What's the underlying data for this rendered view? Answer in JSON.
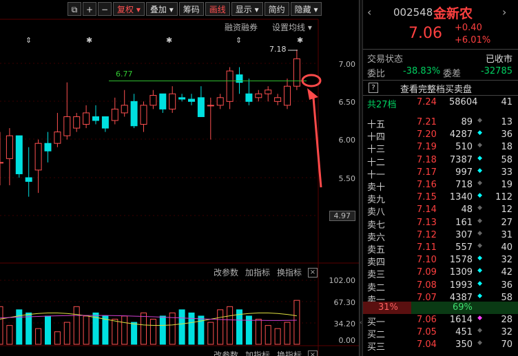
{
  "toolbar": {
    "buttons": [
      "复权",
      "叠加",
      "筹码",
      "画线",
      "显示",
      "简约",
      "隐藏"
    ],
    "icons": [
      "copy-icon",
      "plus-icon",
      "minus-icon"
    ]
  },
  "chart_header": {
    "margin_label": "融资融券",
    "ma_label": "设置均线"
  },
  "annotations": {
    "high_label": "7.18",
    "level_label": "6.77"
  },
  "price_axis": [
    "7.00",
    "6.50",
    "6.00",
    "5.50"
  ],
  "current_price_tag": "4.97",
  "indicator": {
    "buttons": [
      "改参数",
      "加指标",
      "换指标"
    ],
    "axis": [
      "102.00",
      "67.30",
      "34.20",
      "0.00"
    ]
  },
  "bottom_buttons": [
    "改参数",
    "加指标",
    "换指标"
  ],
  "chart_data": {
    "type": "candlestick",
    "candles": [
      {
        "o": 5.7,
        "h": 6.1,
        "l": 5.4,
        "c": 5.7
      },
      {
        "o": 5.75,
        "h": 6.15,
        "l": 5.4,
        "c": 6.05
      },
      {
        "o": 6.05,
        "h": 6.05,
        "l": 5.5,
        "c": 5.55
      },
      {
        "o": 5.5,
        "h": 5.9,
        "l": 5.25,
        "c": 5.45
      },
      {
        "o": 5.6,
        "h": 6.0,
        "l": 5.3,
        "c": 5.95
      },
      {
        "o": 5.95,
        "h": 6.1,
        "l": 5.7,
        "c": 5.85
      },
      {
        "o": 5.95,
        "h": 6.35,
        "l": 5.9,
        "c": 6.1
      },
      {
        "o": 6.05,
        "h": 6.75,
        "l": 6.0,
        "c": 6.3
      },
      {
        "o": 6.15,
        "h": 6.35,
        "l": 6.1,
        "c": 6.3
      },
      {
        "o": 6.2,
        "h": 6.45,
        "l": 6.15,
        "c": 6.35
      },
      {
        "o": 6.3,
        "h": 6.45,
        "l": 6.2,
        "c": 6.25
      },
      {
        "o": 6.3,
        "h": 6.3,
        "l": 6.1,
        "c": 6.15
      },
      {
        "o": 6.25,
        "h": 6.55,
        "l": 6.2,
        "c": 6.4
      },
      {
        "o": 6.35,
        "h": 6.65,
        "l": 6.3,
        "c": 6.45
      },
      {
        "o": 6.5,
        "h": 6.6,
        "l": 6.15,
        "c": 6.18
      },
      {
        "o": 6.2,
        "h": 6.5,
        "l": 6.1,
        "c": 6.45
      },
      {
        "o": 6.45,
        "h": 6.65,
        "l": 6.4,
        "c": 6.58
      },
      {
        "o": 6.6,
        "h": 6.6,
        "l": 6.35,
        "c": 6.4
      },
      {
        "o": 6.4,
        "h": 6.7,
        "l": 6.35,
        "c": 6.6
      },
      {
        "o": 6.55,
        "h": 6.6,
        "l": 6.5,
        "c": 6.53
      },
      {
        "o": 6.53,
        "h": 6.6,
        "l": 6.45,
        "c": 6.5
      },
      {
        "o": 6.55,
        "h": 6.7,
        "l": 6.3,
        "c": 6.3
      },
      {
        "o": 6.45,
        "h": 6.55,
        "l": 6.0,
        "c": 6.45
      },
      {
        "o": 6.45,
        "h": 6.6,
        "l": 6.4,
        "c": 6.55
      },
      {
        "o": 6.5,
        "h": 6.95,
        "l": 6.4,
        "c": 6.9
      },
      {
        "o": 6.85,
        "h": 6.95,
        "l": 6.6,
        "c": 6.75
      },
      {
        "o": 6.6,
        "h": 6.8,
        "l": 6.45,
        "c": 6.5
      },
      {
        "o": 6.55,
        "h": 6.65,
        "l": 6.5,
        "c": 6.6
      },
      {
        "o": 6.6,
        "h": 6.7,
        "l": 6.5,
        "c": 6.65
      },
      {
        "o": 6.5,
        "h": 6.6,
        "l": 6.45,
        "c": 6.55
      },
      {
        "o": 6.45,
        "h": 6.8,
        "l": 6.4,
        "c": 6.7
      },
      {
        "o": 6.7,
        "h": 7.18,
        "l": 6.65,
        "c": 7.06
      }
    ],
    "indicator_bars": [
      60,
      30,
      55,
      50,
      25,
      45,
      20,
      35,
      60,
      45,
      50,
      45,
      40,
      45,
      35,
      50,
      40,
      45,
      50,
      55,
      50,
      45,
      35,
      55,
      60,
      55,
      45,
      40,
      30,
      25,
      35,
      70
    ]
  },
  "side_panel": {
    "code": "002548",
    "name": "金新农",
    "price": "7.06",
    "change": "+0.40",
    "change_pct": "+6.01%",
    "status_label": "交易状态",
    "status_value": "已收市",
    "weibi_label": "委比",
    "weibi_value": "-38.83%",
    "weicha_label": "委差",
    "weicha_value": "-32785",
    "help_icon": "?",
    "full_book_label": "查看完整档买卖盘",
    "total_levels_label": "共27档",
    "total_price": "7.24",
    "total_volume": "58604",
    "total_count": "41",
    "asks": [
      {
        "label": "十五",
        "price": "7.21",
        "vol": "89",
        "dot": "gray",
        "count": "13"
      },
      {
        "label": "十四",
        "price": "7.20",
        "vol": "4287",
        "dot": "cyan",
        "count": "36"
      },
      {
        "label": "十三",
        "price": "7.19",
        "vol": "510",
        "dot": "gray",
        "count": "18"
      },
      {
        "label": "十二",
        "price": "7.18",
        "vol": "7387",
        "dot": "cyan",
        "count": "58"
      },
      {
        "label": "十一",
        "price": "7.17",
        "vol": "997",
        "dot": "cyan",
        "count": "33"
      },
      {
        "label": "卖十",
        "price": "7.16",
        "vol": "718",
        "dot": "gray",
        "count": "19"
      },
      {
        "label": "卖九",
        "price": "7.15",
        "vol": "1340",
        "dot": "cyan",
        "count": "112"
      },
      {
        "label": "卖八",
        "price": "7.14",
        "vol": "48",
        "dot": "gray",
        "count": "12"
      },
      {
        "label": "卖七",
        "price": "7.13",
        "vol": "161",
        "dot": "gray",
        "count": "27"
      },
      {
        "label": "卖六",
        "price": "7.12",
        "vol": "307",
        "dot": "gray",
        "count": "31"
      },
      {
        "label": "卖五",
        "price": "7.11",
        "vol": "557",
        "dot": "gray",
        "count": "40"
      },
      {
        "label": "卖四",
        "price": "7.10",
        "vol": "1578",
        "dot": "cyan",
        "count": "32"
      },
      {
        "label": "卖三",
        "price": "7.09",
        "vol": "1309",
        "dot": "cyan",
        "count": "42"
      },
      {
        "label": "卖二",
        "price": "7.08",
        "vol": "1993",
        "dot": "cyan",
        "count": "36"
      },
      {
        "label": "卖一",
        "price": "7.07",
        "vol": "4387",
        "dot": "cyan",
        "count": "58"
      }
    ],
    "ratio_left": "31%",
    "ratio_right": "69%",
    "ratio_fraction": 0.31,
    "bids": [
      {
        "label": "买一",
        "price": "7.06",
        "vol": "1614",
        "dot": "magenta",
        "count": "28"
      },
      {
        "label": "买二",
        "price": "7.05",
        "vol": "451",
        "dot": "gray",
        "count": "32"
      },
      {
        "label": "买三",
        "price": "7.04",
        "vol": "350",
        "dot": "gray",
        "count": "70"
      }
    ]
  }
}
